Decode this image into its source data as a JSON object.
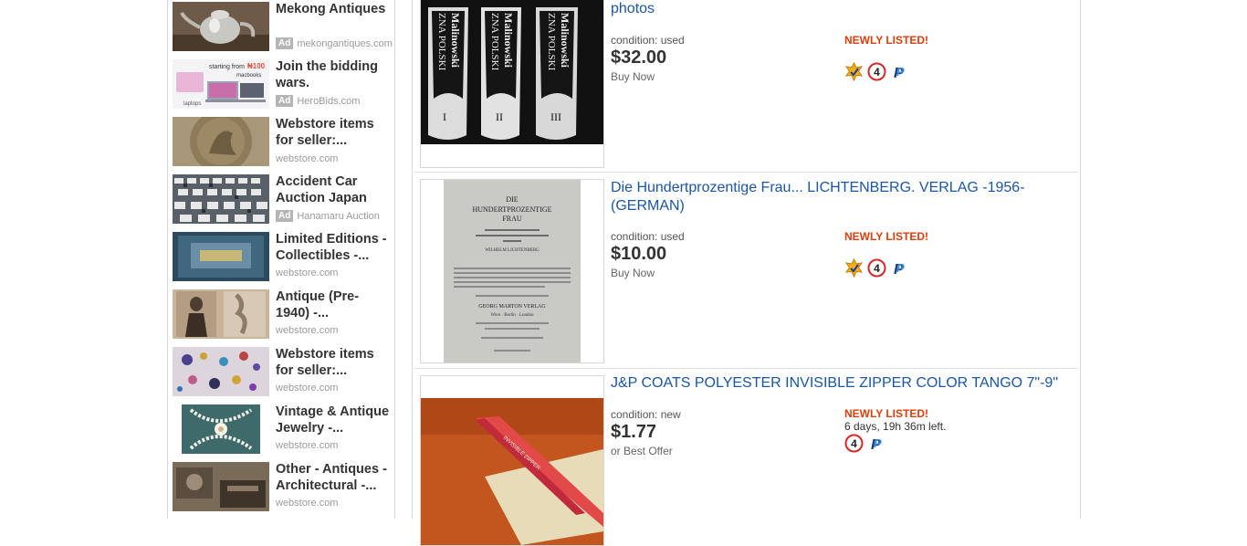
{
  "ads": [
    {
      "title": "Mekong Antiques",
      "source": "mekongantiques.com",
      "is_ad": true
    },
    {
      "title": "Join the bidding wars.",
      "source": "HeroBids.com",
      "is_ad": true,
      "thumb_text": {
        "headline": "starting from",
        "price": "₦100",
        "product": "macbooks",
        "caption": "laptops"
      }
    },
    {
      "title": "Webstore items for seller:...",
      "source": "webstore.com",
      "is_ad": false
    },
    {
      "title": "Accident Car Auction Japan",
      "source": "Hanamaru Auction",
      "is_ad": true
    },
    {
      "title": "Limited Editions - Collectibles -...",
      "source": "webstore.com",
      "is_ad": false
    },
    {
      "title": "Antique (Pre-1940) -...",
      "source": "webstore.com",
      "is_ad": false
    },
    {
      "title": "Webstore items for seller:...",
      "source": "webstore.com",
      "is_ad": false
    },
    {
      "title": "Vintage & Antique Jewelry -...",
      "source": "webstore.com",
      "is_ad": false
    },
    {
      "title": "Other - Antiques - Architectural -...",
      "source": "webstore.com",
      "is_ad": false
    }
  ],
  "ad_badge_label": "Ad",
  "listings": [
    {
      "title": "photos",
      "condition": "condition: used",
      "price": "$32.00",
      "format": "Buy Now",
      "status": "NEWLY LISTED!",
      "time_left": "",
      "icons": [
        "top-rated-seller-icon",
        "returns-4-icon",
        "paypal-icon"
      ],
      "thumb_text": {
        "spine": "Malinowski",
        "subtitle": "ZNA POLSKI",
        "numerals": [
          "I",
          "II",
          "III"
        ]
      }
    },
    {
      "title": "Die Hundertprozentige Frau... LICHTENBERG. VERLAG -1956-(GERMAN)",
      "condition": "condition: used",
      "price": "$10.00",
      "format": "Buy Now",
      "status": "NEWLY LISTED!",
      "time_left": "",
      "icons": [
        "top-rated-seller-icon",
        "returns-4-icon",
        "paypal-icon"
      ],
      "thumb_text": {
        "heading": "DIE",
        "title_line1": "HUNDERTPROZENTIGE",
        "title_line2": "FRAU",
        "author": "WILHELM LICHTENBERG",
        "publisher": "GEORG MARTON VERLAG",
        "cities": "Wien · Berlin · London"
      }
    },
    {
      "title": "J&P COATS POLYESTER INVISIBLE ZIPPER COLOR TANGO 7\"-9\"",
      "condition": "condition: new",
      "price": "$1.77",
      "format": "or Best Offer",
      "status": "NEWLY LISTED!",
      "time_left": "6 days, 19h 36m left.",
      "icons": [
        "returns-4-icon",
        "paypal-icon"
      ],
      "thumb_text": {
        "label": "INVISIBLE ZIPPER"
      }
    }
  ],
  "colors": {
    "link": "#1a56a6",
    "newly_listed": "#dd3d0b",
    "paypal_blue": "#1e3a8a",
    "returns_red": "#d62828"
  }
}
